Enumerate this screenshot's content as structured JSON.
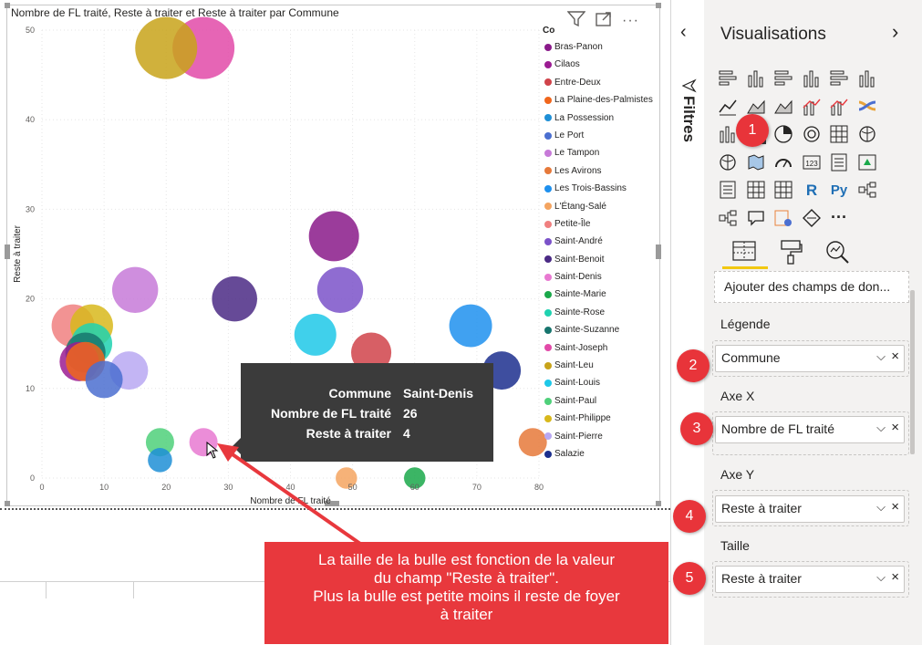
{
  "chart": {
    "title": "Nombre de FL traité, Reste à traiter et Reste à traiter par Commune",
    "legend_title": "Commune",
    "filter_icon": "filter-icon",
    "focus_icon": "focus-mode-icon",
    "more_icon": "more-options-icon"
  },
  "chart_data": {
    "type": "scatter",
    "title": "Nombre de FL traité, Reste à traiter et Reste à traiter par Commune",
    "xlabel": "Nombre de FL traité",
    "ylabel": "Reste à traiter",
    "xlim": [
      0,
      80
    ],
    "ylim": [
      0,
      50
    ],
    "x_ticks": [
      "0",
      "10",
      "20",
      "30",
      "40",
      "50",
      "60",
      "70",
      "80"
    ],
    "y_ticks": [
      "0",
      "10",
      "20",
      "30",
      "40",
      "50"
    ],
    "size_field": "Reste à traiter",
    "grid": true,
    "legend_position": "right",
    "series": [
      {
        "name": "Bras-Panon",
        "color": "#8a1a8a",
        "points": [
          [
            47,
            27
          ]
        ]
      },
      {
        "name": "Cilaos",
        "color": "#9b1c92",
        "points": [
          [
            6,
            13
          ]
        ]
      },
      {
        "name": "Entre-Deux",
        "color": "#d0434a",
        "points": [
          [
            53,
            14
          ]
        ]
      },
      {
        "name": "La Plaine-des-Palmistes",
        "color": "#f0661c",
        "points": [
          [
            7,
            13
          ]
        ]
      },
      {
        "name": "La Possession",
        "color": "#1f8fd6",
        "points": [
          [
            19,
            2
          ]
        ]
      },
      {
        "name": "Le Port",
        "color": "#4b6fd0",
        "points": [
          [
            10,
            11
          ]
        ]
      },
      {
        "name": "Le Tampon",
        "color": "#c77ad8",
        "points": [
          [
            15,
            21
          ]
        ]
      },
      {
        "name": "Les Avirons",
        "color": "#e6793a",
        "points": [
          [
            79,
            4
          ]
        ]
      },
      {
        "name": "Les Trois-Bassins",
        "color": "#1e90ee",
        "points": [
          [
            69,
            17
          ]
        ]
      },
      {
        "name": "L'Étang-Salé",
        "color": "#f4a460",
        "points": [
          [
            49,
            0
          ]
        ]
      },
      {
        "name": "Petite-Île",
        "color": "#f08080",
        "points": [
          [
            5,
            17
          ]
        ]
      },
      {
        "name": "Saint-André",
        "color": "#7b52c9",
        "points": [
          [
            48,
            21
          ]
        ]
      },
      {
        "name": "Saint-Benoit",
        "color": "#4b2a85",
        "points": [
          [
            31,
            20
          ]
        ]
      },
      {
        "name": "Saint-Denis",
        "color": "#e879d1",
        "points": [
          [
            26,
            4
          ]
        ]
      },
      {
        "name": "Sainte-Marie",
        "color": "#1aa84a",
        "points": [
          [
            60,
            0
          ]
        ]
      },
      {
        "name": "Sainte-Rose",
        "color": "#1fd2b0",
        "points": [
          [
            8,
            15
          ]
        ]
      },
      {
        "name": "Sainte-Suzanne",
        "color": "#17756e",
        "points": [
          [
            7,
            14
          ]
        ]
      },
      {
        "name": "Saint-Joseph",
        "color": "#e24aa8",
        "points": [
          [
            26,
            48
          ]
        ]
      },
      {
        "name": "Saint-Leu",
        "color": "#c8a31a",
        "points": [
          [
            20,
            48
          ]
        ]
      },
      {
        "name": "Saint-Louis",
        "color": "#1ec8e8",
        "points": [
          [
            44,
            16
          ]
        ]
      },
      {
        "name": "Saint-Paul",
        "color": "#4fd07a",
        "points": [
          [
            19,
            4
          ]
        ]
      },
      {
        "name": "Saint-Philippe",
        "color": "#d8b81c",
        "points": [
          [
            8,
            17
          ]
        ]
      },
      {
        "name": "Saint-Pierre",
        "color": "#b9a8f2",
        "points": [
          [
            14,
            12
          ]
        ]
      },
      {
        "name": "Salazie",
        "color": "#1c2f8e",
        "points": [
          [
            74,
            12
          ]
        ]
      }
    ]
  },
  "tooltip": {
    "rows": [
      {
        "key": "Commune",
        "value": "Saint-Denis"
      },
      {
        "key": "Nombre de FL traité",
        "value": "26"
      },
      {
        "key": "Reste à traiter",
        "value": "4"
      }
    ]
  },
  "filters": {
    "label": "Filtres",
    "collapse_icon": "chevron-left-icon",
    "filter_icon": "filter-icon"
  },
  "viz_pane": {
    "title": "Visualisations",
    "expand_icon": "chevron-right-icon",
    "visual_icons": [
      "stacked-bar-icon",
      "stacked-column-icon",
      "clustered-bar-icon",
      "clustered-column-icon",
      "100-bar-icon",
      "100-column-icon",
      "line-chart-icon",
      "area-chart-icon",
      "stacked-area-icon",
      "line-column-icon",
      "line-clustered-icon",
      "ribbon-chart-icon",
      "waterfall-icon",
      "scatter-chart-icon",
      "pie-chart-icon",
      "donut-chart-icon",
      "treemap-icon",
      "map-icon",
      "globe-map-icon",
      "filled-map-icon",
      "gauge-icon",
      "card-icon",
      "multi-row-card-icon",
      "kpi-icon",
      "slicer-icon",
      "table-icon",
      "matrix-icon",
      "r-visual-icon",
      "python-visual-icon",
      "key-influencers-icon",
      "decomposition-tree-icon",
      "qa-icon",
      "smart-narrative-icon",
      "power-apps-icon",
      "more-visuals-icon"
    ],
    "r_text": "R",
    "py_text": "Py",
    "more_text": "···",
    "tabs": [
      "fields-tab-icon",
      "format-tab-icon",
      "analytics-tab-icon"
    ],
    "add_fields": "Ajouter des champs de don...",
    "legend_label": "Légende",
    "legend_value": "Commune",
    "x_label": "Axe X",
    "x_value": "Nombre de FL traité",
    "y_label": "Axe Y",
    "y_value": "Reste à traiter",
    "size_label": "Taille",
    "size_value": "Reste à traiter"
  },
  "badges": [
    "1",
    "2",
    "3",
    "4",
    "5"
  ],
  "callout": {
    "lines": [
      "La taille de la bulle est fonction de la valeur",
      "du champ \"Reste à traiter\".",
      "Plus la bulle est petite moins il reste de foyer",
      "à traiter"
    ]
  }
}
